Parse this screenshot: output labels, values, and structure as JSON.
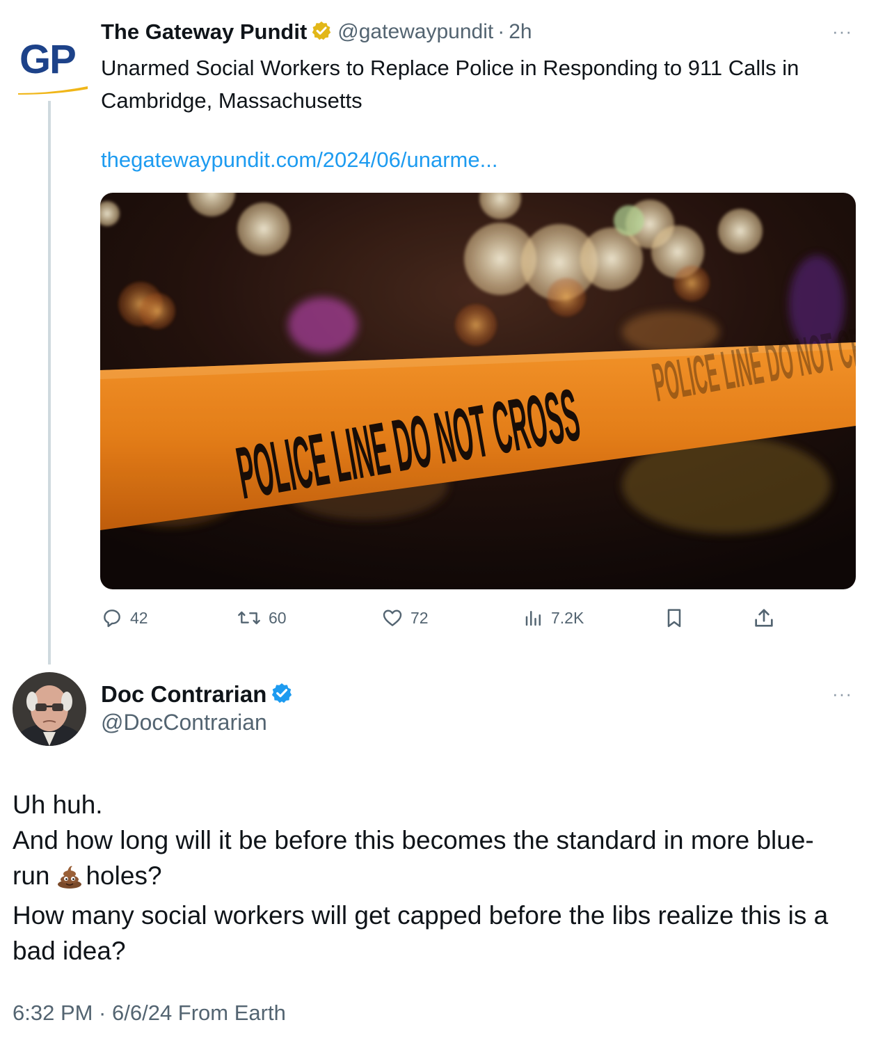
{
  "quoted_tweet": {
    "logo_text": "GP",
    "author_name": "The Gateway Pundit",
    "handle": "@gatewaypundit",
    "separator": "·",
    "time_ago": "2h",
    "more_label": "···",
    "text": "Unarmed Social Workers to Replace Police in Responding to 911 Calls in Cambridge, Massachusetts",
    "link": "thegatewaypundit.com/2024/06/unarme...",
    "media_caption": "POLICE LINE DO NOT CROSS",
    "actions": {
      "replies": "42",
      "reposts": "60",
      "likes": "72",
      "views": "7.2K"
    }
  },
  "main_tweet": {
    "author_name": "Doc Contrarian",
    "handle": "@DocContrarian",
    "more_label": "···",
    "lines": [
      "Uh huh.",
      "And how long will it be before this becomes the standard in more blue-",
      "run",
      "holes?",
      "How many social workers will get capped before the libs realize this is a",
      "bad idea?"
    ],
    "footer": "6:32 PM · 6/6/24 From Earth"
  },
  "colors": {
    "link": "#1d9bf0",
    "secondary_text": "#536471",
    "gold_badge": "#e2b719",
    "blue_badge": "#1d9bf0",
    "tape_orange": "#f08a1c"
  }
}
